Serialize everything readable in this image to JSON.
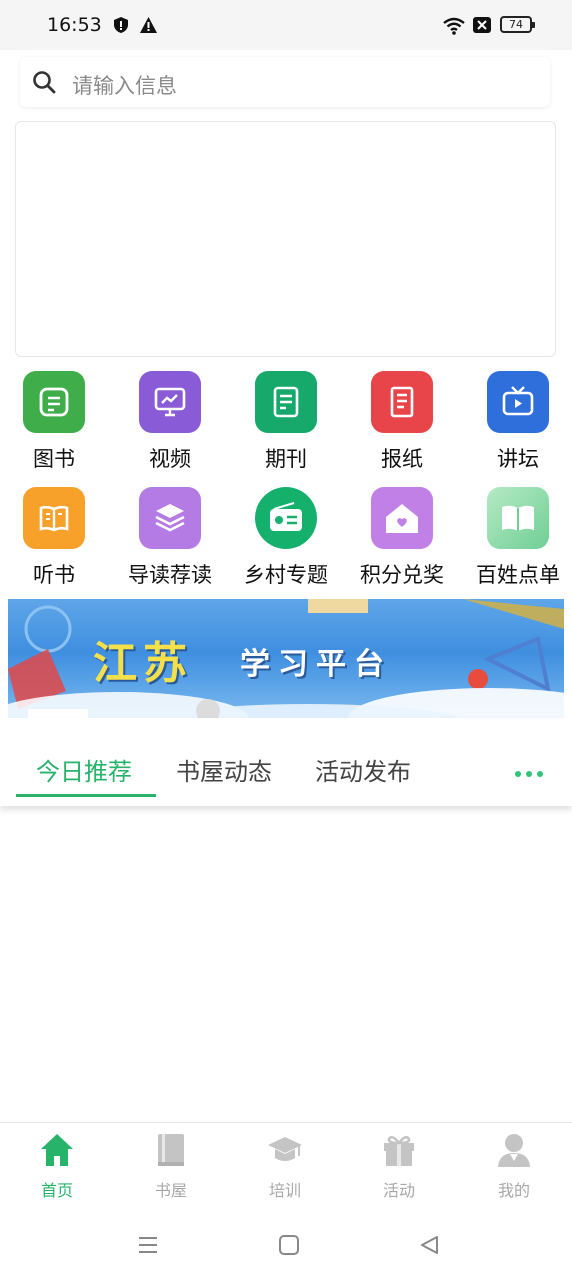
{
  "status_bar": {
    "time": "16:53",
    "battery": "74",
    "icons": [
      "shield-alert-icon",
      "warning-icon",
      "wifi-icon",
      "sim-blocked-icon",
      "battery-icon"
    ]
  },
  "search": {
    "placeholder": "请输入信息"
  },
  "grid": [
    {
      "label": "图书",
      "icon": "book-icon",
      "color": "#3fae4a"
    },
    {
      "label": "视频",
      "icon": "video-icon",
      "color": "#8a5bd6"
    },
    {
      "label": "期刊",
      "icon": "journal-icon",
      "color": "#17a86b"
    },
    {
      "label": "报纸",
      "icon": "newspaper-icon",
      "color": "#e8454a"
    },
    {
      "label": "讲坛",
      "icon": "tv-icon",
      "color": "#2f6fdc"
    },
    {
      "label": "听书",
      "icon": "audiobook-icon",
      "color": "#f7a02a"
    },
    {
      "label": "导读荐读",
      "icon": "layers-icon",
      "color": "#b37be3"
    },
    {
      "label": "乡村专题",
      "icon": "radio-icon",
      "color": "#14b06c"
    },
    {
      "label": "积分兑奖",
      "icon": "house-heart-icon",
      "color": "#c080e6"
    },
    {
      "label": "百姓点单",
      "icon": "open-book-icon",
      "color": "#8fd8a8"
    }
  ],
  "promo": {
    "title": "江苏",
    "subtitle": "学习平台"
  },
  "tabs": [
    {
      "label": "今日推荐",
      "active": true
    },
    {
      "label": "书屋动态",
      "active": false
    },
    {
      "label": "活动发布",
      "active": false
    }
  ],
  "bottom_nav": [
    {
      "label": "首页",
      "icon": "home-icon",
      "active": true
    },
    {
      "label": "书屋",
      "icon": "bookshelf-icon",
      "active": false
    },
    {
      "label": "培训",
      "icon": "graduation-cap-icon",
      "active": false
    },
    {
      "label": "活动",
      "icon": "gift-icon",
      "active": false
    },
    {
      "label": "我的",
      "icon": "user-icon",
      "active": false
    }
  ],
  "colors": {
    "accent": "#27b36a",
    "inactive": "#a8a8a8"
  }
}
